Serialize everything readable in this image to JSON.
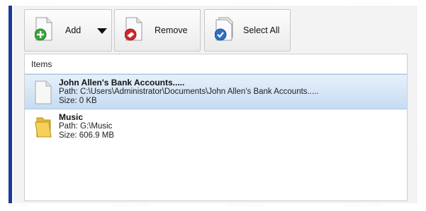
{
  "toolbar": {
    "add_label": "Add",
    "remove_label": "Remove",
    "select_all_label": "Select All"
  },
  "list": {
    "header": "Items",
    "items": [
      {
        "name": "John Allen's Bank Accounts.....",
        "path": "Path: C:\\Users\\Administrator\\Documents\\John Allen's Bank Accounts.....",
        "size": "Size: 0 KB",
        "type": "document-icon",
        "selected": true
      },
      {
        "name": "Music",
        "path": "Path: G:\\Music",
        "size": "Size: 606.9 MB",
        "type": "folder-icon",
        "selected": false
      }
    ]
  },
  "colors": {
    "accent_bar": "#1b3a9a",
    "selection": "#c7dcf2",
    "add_green": "#3aa33a",
    "remove_red": "#cc2a2a",
    "select_blue": "#2f6fc6"
  }
}
